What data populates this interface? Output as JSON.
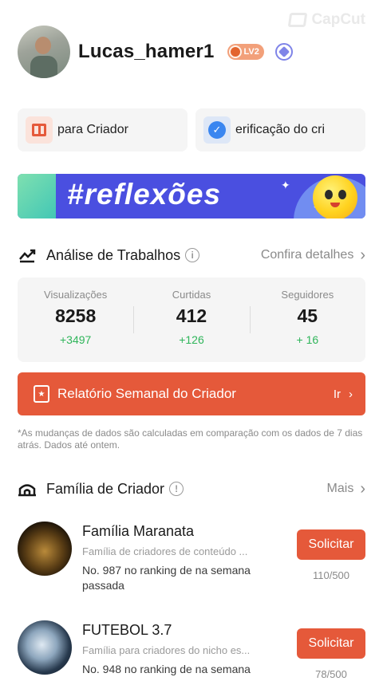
{
  "watermark": "CapCut",
  "profile": {
    "username": "Lucas_hamer1",
    "level": "LV2"
  },
  "shortcuts": [
    {
      "label": "para Criador",
      "icon": "gift-icon"
    },
    {
      "label": "erificação do cri",
      "icon": "verified-check-icon"
    }
  ],
  "banner": {
    "text": "#reflexões"
  },
  "analysis": {
    "title": "Análise de Trabalhos",
    "link": "Confira detalhes",
    "stats": [
      {
        "label": "Visualizações",
        "value": "8258",
        "delta": "+3497"
      },
      {
        "label": "Curtidas",
        "value": "412",
        "delta": "+126"
      },
      {
        "label": "Seguidores",
        "value": "45",
        "delta": "+ 16"
      }
    ]
  },
  "report": {
    "label": "Relatório Semanal do Criador",
    "go": "Ir"
  },
  "note": "*As mudanças de dados são calculadas em comparação com os dados de 7 dias atrás. Dados até ontem.",
  "family": {
    "title": "Família de Criador",
    "link": "Mais",
    "items": [
      {
        "name": "Família Maranata",
        "desc": "Família de criadores de conteúdo ...",
        "rank": "No. 987 no ranking de na semana passada",
        "button": "Solicitar",
        "count": "110/500"
      },
      {
        "name": "FUTEBOL 3.7",
        "desc": "Família para criadores do nicho es...",
        "rank": "No. 948 no ranking de na semana",
        "button": "Solicitar",
        "count": "78/500"
      }
    ]
  },
  "colors": {
    "accent": "#e5593a",
    "positive": "#2fb55a",
    "muted": "#8a8a8a"
  }
}
